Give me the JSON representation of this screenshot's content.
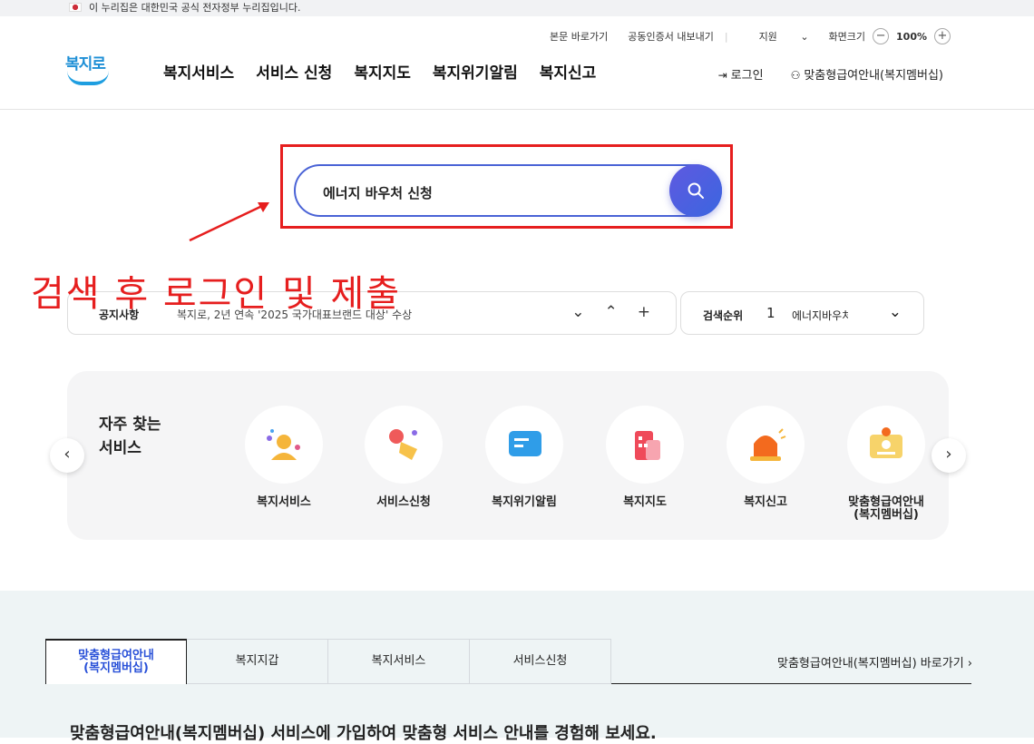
{
  "gov_banner": "이 누리집은 대한민국 공식 전자정부 누리집입니다.",
  "util": {
    "skip": "본문 바로가기",
    "cert": "공동인증서 내보내기",
    "support": "지원",
    "zoom_label": "화면크기",
    "zoom_value": "100%"
  },
  "logo_text": "복지로",
  "gnb": [
    "복지서비스",
    "서비스 신청",
    "복지지도",
    "복지위기알림",
    "복지신고"
  ],
  "member": {
    "login": "로그인",
    "membership": "맞춤형급여안내(복지멤버십)"
  },
  "search": {
    "query": "에너지 바우처 신청"
  },
  "annotation": "검색 후 로그인 및 제출",
  "notice": {
    "label": "공지사항",
    "text": "복지로, 2년 연속 '2025 국가대표브랜드 대상' 수상"
  },
  "rank": {
    "label": "검색순위",
    "num": "1",
    "keyword": "에너지바우처"
  },
  "fav": {
    "title_line1": "자주 찾는",
    "title_line2": "서비스",
    "items": [
      "복지서비스",
      "서비스신청",
      "복지위기알림",
      "복지지도",
      "복지신고",
      "맞춤형급여안내\n(복지멤버십)"
    ]
  },
  "tabs": [
    "맞춤형급여안내\n(복지멤버십)",
    "복지지갑",
    "복지서비스",
    "서비스신청"
  ],
  "goto": "맞춤형급여안내(복지멤버십) 바로가기",
  "headline": "맞춤형급여안내(복지멤버십) 서비스에 가입하여 맞춤형 서비스 안내를 경험해 보세요.",
  "colors": {
    "accent": "#4a63d6",
    "annotation": "#e61e1e"
  }
}
